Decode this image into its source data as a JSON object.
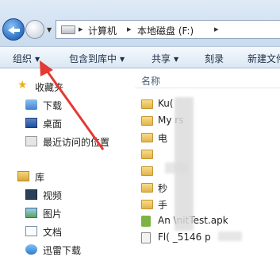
{
  "address_bar": {
    "path": [
      "计算机",
      "本地磁盘 (F:)"
    ]
  },
  "toolbar": {
    "organize": "组织",
    "include_in_library": "包含到库中",
    "share": "共享",
    "burn": "刻录",
    "new_folder": "新建文件"
  },
  "nav": {
    "favorites_label": "收藏夹",
    "favorites": [
      "下载",
      "桌面",
      "最近访问的位置"
    ],
    "libraries_label": "库",
    "libraries": [
      "视频",
      "图片",
      "文档",
      "迅雷下载"
    ]
  },
  "content": {
    "column_name": "名称",
    "files": [
      "Ku(",
      "My        rs",
      "电",
      "",
      "",
      "秒",
      "手",
      "An     \\nitTest.apk",
      "Fl(         _5146       p"
    ]
  },
  "annotation": {
    "color": "#e53935"
  }
}
